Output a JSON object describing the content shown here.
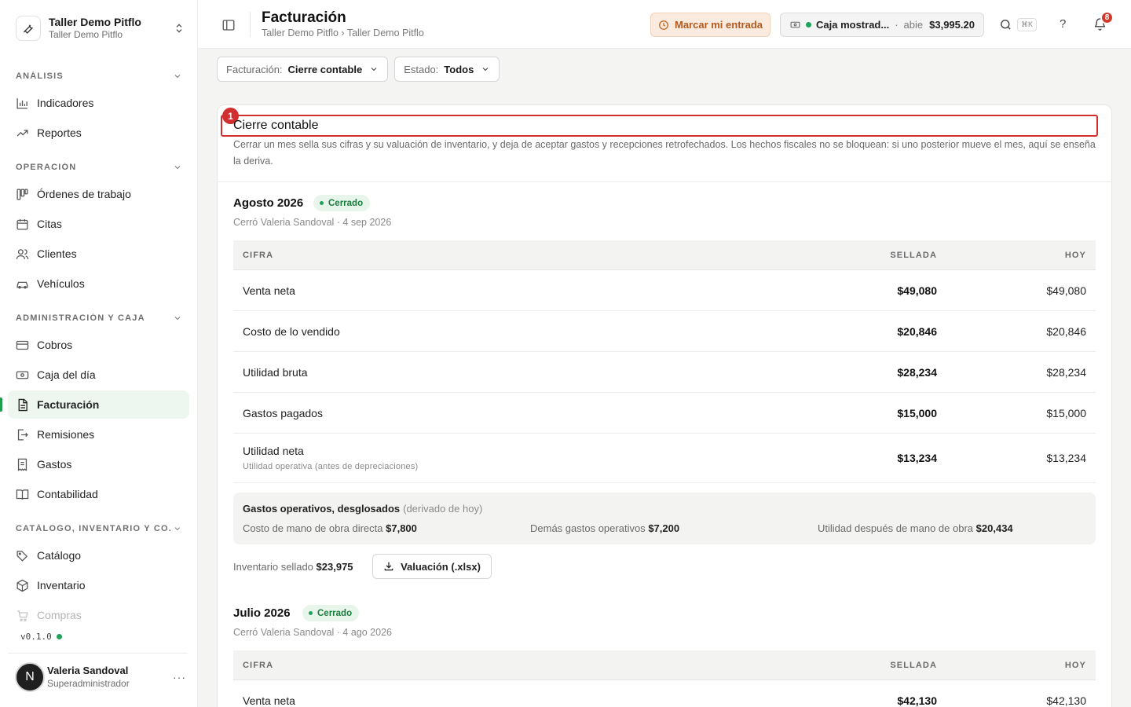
{
  "workspace": {
    "name": "Taller Demo Pitflo",
    "sub": "Taller Demo Pitflo"
  },
  "sidebar": {
    "sections": [
      {
        "label": "ANÁLISIS",
        "items": [
          {
            "label": "Indicadores",
            "icon": "bar-chart-icon"
          },
          {
            "label": "Reportes",
            "icon": "trend-icon"
          }
        ]
      },
      {
        "label": "OPERACIÓN",
        "items": [
          {
            "label": "Órdenes de trabajo",
            "icon": "kanban-icon"
          },
          {
            "label": "Citas",
            "icon": "calendar-icon"
          },
          {
            "label": "Clientes",
            "icon": "users-icon"
          },
          {
            "label": "Vehículos",
            "icon": "car-icon"
          }
        ]
      },
      {
        "label": "ADMINISTRACIÓN Y CAJA",
        "items": [
          {
            "label": "Cobros",
            "icon": "card-icon"
          },
          {
            "label": "Caja del día",
            "icon": "cash-icon"
          },
          {
            "label": "Facturación",
            "icon": "invoice-icon"
          },
          {
            "label": "Remisiones",
            "icon": "export-doc-icon"
          },
          {
            "label": "Gastos",
            "icon": "receipt-icon"
          },
          {
            "label": "Contabilidad",
            "icon": "book-icon"
          }
        ]
      },
      {
        "label": "CATÁLOGO, INVENTARIO Y CO...",
        "items": [
          {
            "label": "Catálogo",
            "icon": "tags-icon"
          },
          {
            "label": "Inventario",
            "icon": "box-icon"
          },
          {
            "label": "Compras",
            "icon": "cart-icon"
          }
        ]
      }
    ],
    "active": "Facturación",
    "version": "v0.1.0",
    "user": {
      "initial": "N",
      "name": "Valeria Sandoval",
      "role": "Superadministrador",
      "more": "···"
    }
  },
  "topbar": {
    "title": "Facturación",
    "breadcrumb": "Taller Demo Pitflo › Taller Demo Pitflo",
    "entrada_label": "Marcar mi entrada",
    "caja": {
      "name": "Caja mostrad...",
      "sep": "·",
      "status": "abie",
      "amount": "$3,995.20"
    },
    "shortcut": "⌘K",
    "help": "?",
    "notifications": "8"
  },
  "filters": [
    {
      "label": "Facturación:",
      "value": "Cierre contable"
    },
    {
      "label": "Estado:",
      "value": "Todos"
    }
  ],
  "card": {
    "highlight_index": "1",
    "title": "Cierre contable",
    "description": "Cerrar un mes sella sus cifras y su valuación de inventario, y deja de aceptar gastos y recepciones retrofechados. Los hechos fiscales no se bloquean: si uno posterior mueve el mes, aquí se enseña la deriva."
  },
  "table_headers": {
    "cifra": "CIFRA",
    "sellada": "SELLADA",
    "hoy": "HOY"
  },
  "months": [
    {
      "title": "Agosto 2026",
      "status": "Cerrado",
      "closed_by": "Cerró Valeria Sandoval · 4 sep 2026",
      "rows": [
        {
          "label": "Venta neta",
          "sellada": "$49,080",
          "hoy": "$49,080"
        },
        {
          "label": "Costo de lo vendido",
          "sellada": "$20,846",
          "hoy": "$20,846"
        },
        {
          "label": "Utilidad bruta",
          "sellada": "$28,234",
          "hoy": "$28,234"
        },
        {
          "label": "Gastos pagados",
          "sellada": "$15,000",
          "hoy": "$15,000"
        },
        {
          "label": "Utilidad neta",
          "note": "Utilidad operativa (antes de depreciaciones)",
          "sellada": "$13,234",
          "hoy": "$13,234"
        }
      ],
      "ops": {
        "title": "Gastos operativos, desglosados",
        "derived": "(derivado de hoy)",
        "items": [
          {
            "label": "Costo de mano de obra directa",
            "value": "$7,800"
          },
          {
            "label": "Demás gastos operativos",
            "value": "$7,200"
          },
          {
            "label": "Utilidad después de mano de obra",
            "value": "$20,434"
          }
        ]
      },
      "inventory_label": "Inventario sellado",
      "inventory_value": "$23,975",
      "download_label": "Valuación (.xlsx)"
    },
    {
      "title": "Julio 2026",
      "status": "Cerrado",
      "closed_by": "Cerró Valeria Sandoval · 4 ago 2026",
      "rows": [
        {
          "label": "Venta neta",
          "sellada": "$42,130",
          "hoy": "$42,130"
        }
      ]
    }
  ]
}
